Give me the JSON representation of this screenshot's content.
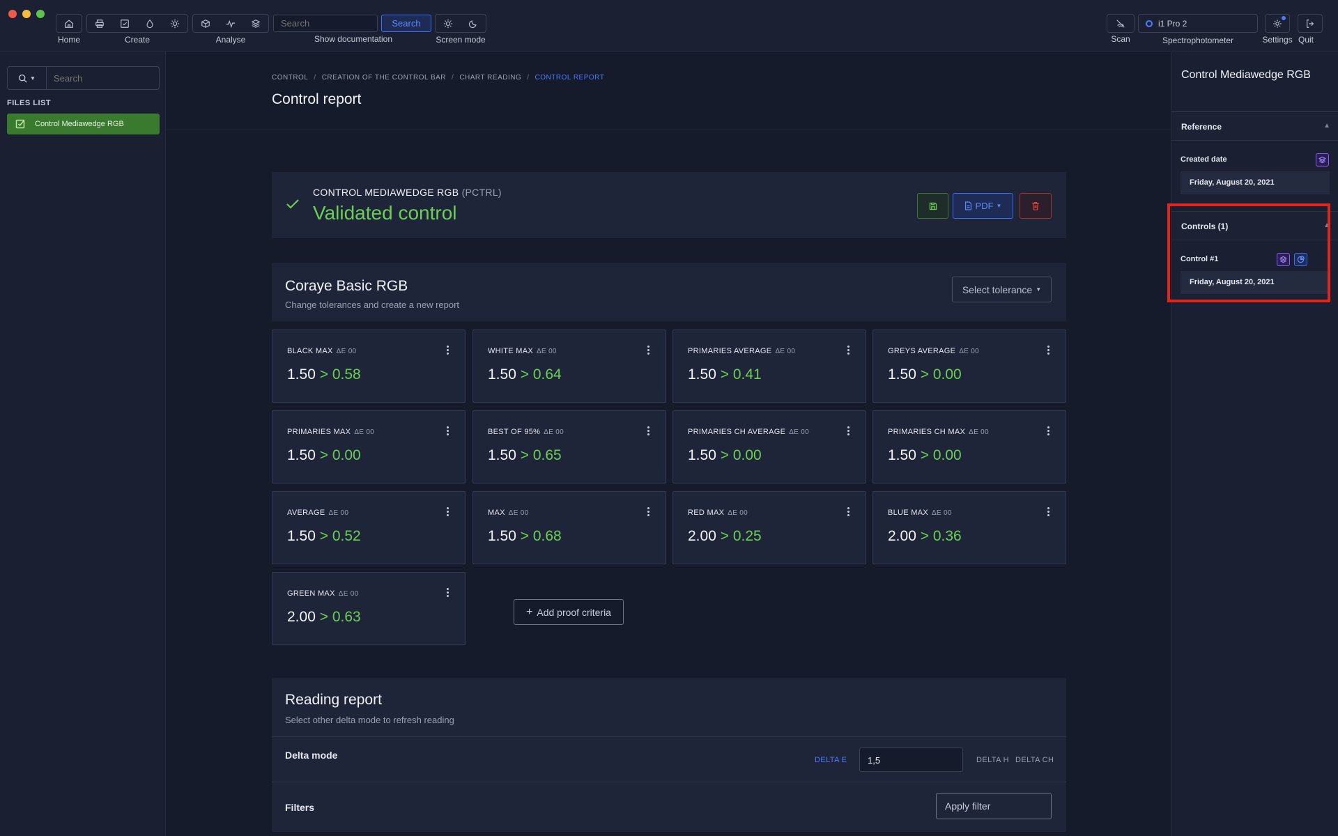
{
  "toolbar": {
    "home_label": "Home",
    "create_label": "Create",
    "analyse_label": "Analyse",
    "search_placeholder": "Search",
    "search_button": "Search",
    "show_documentation": "Show documentation",
    "screen_mode_label": "Screen mode",
    "scan_label": "Scan",
    "device_name": "i1 Pro 2",
    "spectrophotometer_label": "Spectrophotometer",
    "settings_label": "Settings",
    "quit_label": "Quit"
  },
  "sidebar": {
    "search_placeholder": "Search",
    "files_title": "FILES LIST",
    "files": [
      {
        "label": "Control Mediawedge RGB"
      }
    ]
  },
  "breadcrumb": {
    "items": [
      "CONTROL",
      "CREATION OF THE CONTROL BAR",
      "CHART READING"
    ],
    "active": "CONTROL REPORT"
  },
  "page_title": "Control report",
  "status": {
    "name": "CONTROL MEDIAWEDGE RGB",
    "code": "(PCTRL)",
    "text": "Validated control",
    "pdf_label": "PDF"
  },
  "tolerance": {
    "title": "Coraye Basic RGB",
    "subtitle": "Change tolerances and create a new report",
    "select_label": "Select tolerance",
    "unit": "ΔE 00",
    "cards": [
      {
        "label": "BLACK MAX",
        "tolerance": "1.50",
        "value": "> 0.58"
      },
      {
        "label": "WHITE MAX",
        "tolerance": "1.50",
        "value": "> 0.64"
      },
      {
        "label": "PRIMARIES AVERAGE",
        "tolerance": "1.50",
        "value": "> 0.41"
      },
      {
        "label": "GREYS AVERAGE",
        "tolerance": "1.50",
        "value": "> 0.00"
      },
      {
        "label": "PRIMARIES MAX",
        "tolerance": "1.50",
        "value": "> 0.00"
      },
      {
        "label": "BEST OF 95%",
        "tolerance": "1.50",
        "value": "> 0.65"
      },
      {
        "label": "PRIMARIES CH AVERAGE",
        "tolerance": "1.50",
        "value": "> 0.00"
      },
      {
        "label": "PRIMARIES CH MAX",
        "tolerance": "1.50",
        "value": "> 0.00"
      },
      {
        "label": "AVERAGE",
        "tolerance": "1.50",
        "value": "> 0.52"
      },
      {
        "label": "MAX",
        "tolerance": "1.50",
        "value": "> 0.68"
      },
      {
        "label": "RED MAX",
        "tolerance": "2.00",
        "value": "> 0.25"
      },
      {
        "label": "BLUE MAX",
        "tolerance": "2.00",
        "value": "> 0.36"
      },
      {
        "label": "GREEN MAX",
        "tolerance": "2.00",
        "value": "> 0.63"
      }
    ],
    "add_label": "Add proof criteria"
  },
  "reading": {
    "title": "Reading report",
    "subtitle": "Select other delta mode to refresh reading",
    "delta_mode_label": "Delta mode",
    "delta_e": "DELTA E",
    "delta_value": "1,5",
    "delta_h": "DELTA H",
    "delta_ch": "DELTA CH",
    "filters_label": "Filters",
    "apply_filter": "Apply filter"
  },
  "right_panel": {
    "title": "Control Mediawedge RGB",
    "reference_title": "Reference",
    "created_label": "Created date",
    "created_date": "Friday, August 20, 2021",
    "controls_title": "Controls (1)",
    "control_label": "Control #1",
    "control_date": "Friday, August 20, 2021"
  },
  "colors": {
    "accent": "#4c7bff",
    "success": "#6ccf55",
    "danger": "#e0261b"
  }
}
